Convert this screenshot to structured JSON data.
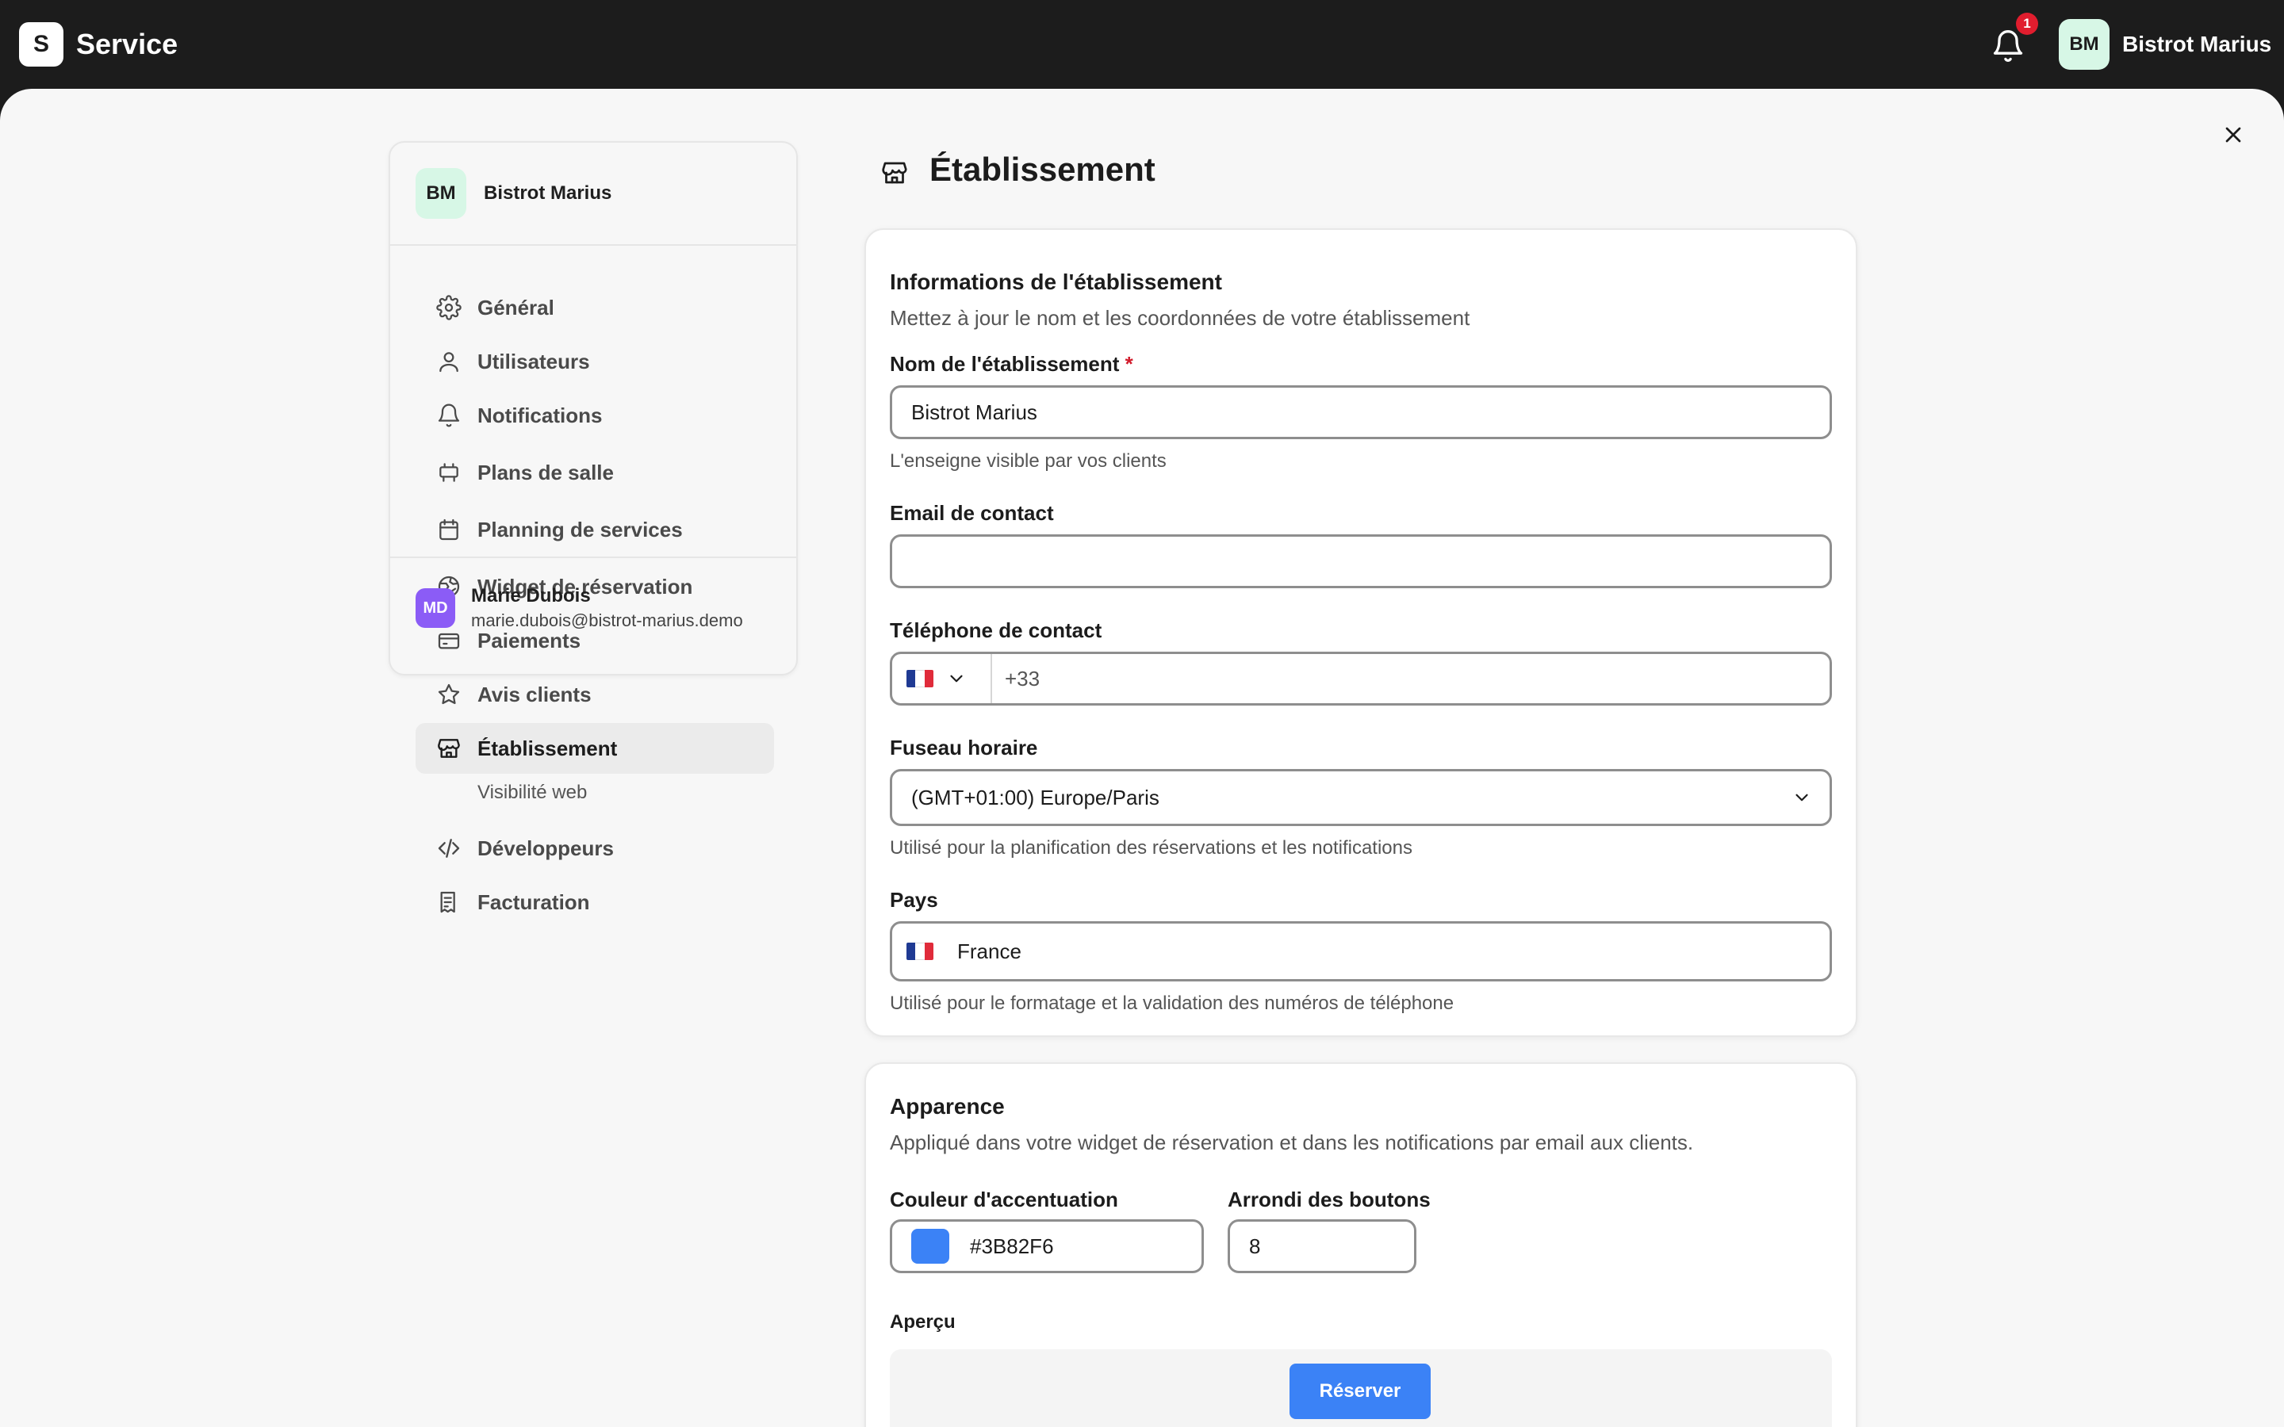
{
  "app": {
    "logo_letter": "S",
    "title": "Service"
  },
  "topbar": {
    "notification_count": "1",
    "user_initials": "BM",
    "user_name": "Bistrot Marius"
  },
  "sidebar": {
    "header": {
      "initials": "BM",
      "name": "Bistrot Marius"
    },
    "items": [
      {
        "label": "Général",
        "icon": "gear-icon"
      },
      {
        "label": "Utilisateurs",
        "icon": "user-icon"
      },
      {
        "label": "Notifications",
        "icon": "bell-icon"
      },
      {
        "label": "Plans de salle",
        "icon": "table-icon"
      },
      {
        "label": "Planning de services",
        "icon": "calendar-icon"
      },
      {
        "label": "Widget de réservation",
        "icon": "globe-icon"
      },
      {
        "label": "Paiements",
        "icon": "credit-card-icon"
      },
      {
        "label": "Avis clients",
        "icon": "star-icon"
      },
      {
        "label": "Établissement",
        "icon": "store-icon",
        "active": true
      },
      {
        "label": "Développeurs",
        "icon": "code-icon"
      },
      {
        "label": "Facturation",
        "icon": "receipt-icon"
      }
    ],
    "subitem": "Visibilité web",
    "footer": {
      "initials": "MD",
      "name": "Marie Dubois",
      "email": "marie.dubois@bistrot-marius.demo"
    }
  },
  "page": {
    "title": "Établissement",
    "icon": "store-icon"
  },
  "info_card": {
    "title": "Informations de l'établissement",
    "subtitle": "Mettez à jour le nom et les coordonnées de votre établissement",
    "name_label": "Nom de l'établissement",
    "name_required": "*",
    "name_value": "Bistrot Marius",
    "name_hint": "L'enseigne visible par vos clients",
    "email_label": "Email de contact",
    "email_value": "",
    "phone_label": "Téléphone de contact",
    "phone_prefix": "+33",
    "timezone_label": "Fuseau horaire",
    "timezone_value": "(GMT+01:00) Europe/Paris",
    "timezone_hint": "Utilisé pour la planification des réservations et les notifications",
    "country_label": "Pays",
    "country_value": "France",
    "country_hint": "Utilisé pour le formatage et la validation des numéros de téléphone"
  },
  "appearance_card": {
    "title": "Apparence",
    "subtitle": "Appliqué dans votre widget de réservation et dans les notifications par email aux clients.",
    "accent_label": "Couleur d'accentuation",
    "accent_value": "#3B82F6",
    "radius_label": "Arrondi des boutons",
    "radius_value": "8",
    "preview_label": "Aperçu",
    "preview_button": "Réserver"
  },
  "colors": {
    "accent": "#3B82F6",
    "topbar": "#1c1c1c",
    "avatar_green": "#d7f7e6",
    "avatar_purple": "#8b5cf6",
    "badge_red": "#e11d2e"
  }
}
